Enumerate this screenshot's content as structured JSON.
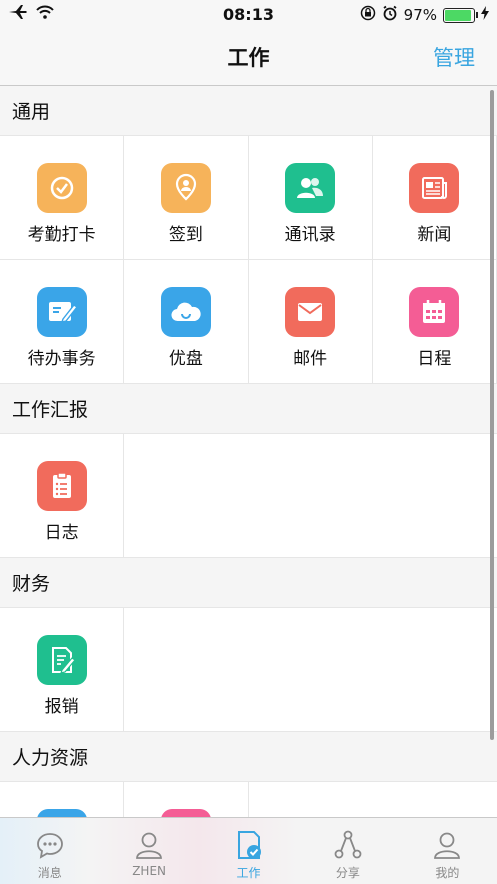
{
  "status_bar": {
    "time": "08:13",
    "battery": "97%"
  },
  "nav": {
    "title": "工作",
    "manage": "管理"
  },
  "sections": [
    {
      "title": "通用",
      "items": [
        {
          "label": "考勤打卡",
          "icon": "clock-check-icon",
          "color": "#f6b35a"
        },
        {
          "label": "签到",
          "icon": "location-pin-icon",
          "color": "#f6b35a"
        },
        {
          "label": "通讯录",
          "icon": "contacts-icon",
          "color": "#1fbf8f"
        },
        {
          "label": "新闻",
          "icon": "newspaper-icon",
          "color": "#f16b5c"
        },
        {
          "label": "待办事务",
          "icon": "todo-edit-icon",
          "color": "#3aa5e8"
        },
        {
          "label": "优盘",
          "icon": "cloud-icon",
          "color": "#3aa5e8"
        },
        {
          "label": "邮件",
          "icon": "mail-icon",
          "color": "#f16b5c"
        },
        {
          "label": "日程",
          "icon": "calendar-icon",
          "color": "#f45d95"
        }
      ]
    },
    {
      "title": "工作汇报",
      "items": [
        {
          "label": "日志",
          "icon": "clipboard-icon",
          "color": "#f16b5c"
        }
      ]
    },
    {
      "title": "财务",
      "items": [
        {
          "label": "报销",
          "icon": "reimburse-icon",
          "color": "#1fbf8f"
        }
      ]
    },
    {
      "title": "人力资源",
      "items": []
    }
  ],
  "tabs": [
    {
      "label": "消息",
      "icon": "chat-bubble-icon"
    },
    {
      "label": "ZHEN",
      "icon": "person-icon"
    },
    {
      "label": "工作",
      "icon": "work-icon",
      "active": true
    },
    {
      "label": "分享",
      "icon": "share-icon"
    },
    {
      "label": "我的",
      "icon": "profile-icon"
    }
  ]
}
